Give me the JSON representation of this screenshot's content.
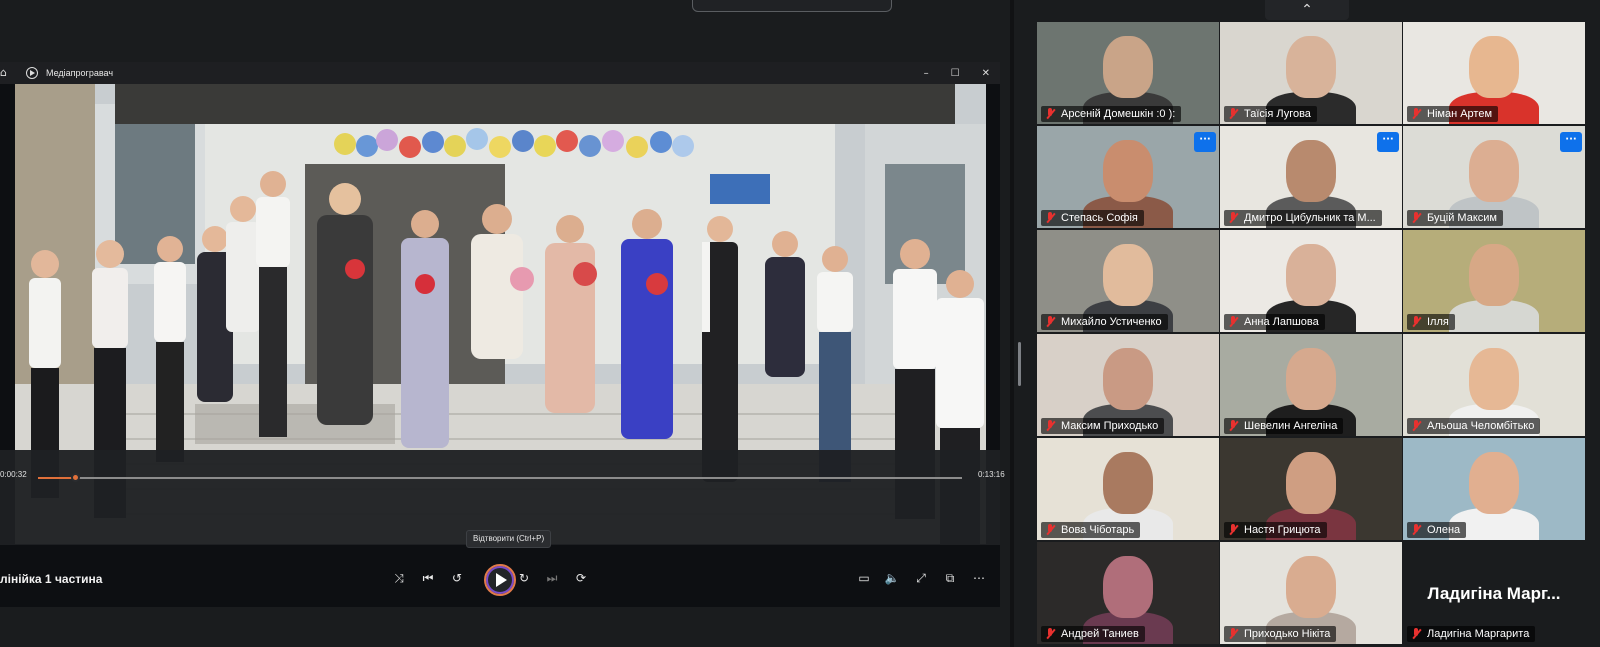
{
  "player": {
    "window_title": "Медіапрогравач",
    "title_controls": [
      "–",
      "☐",
      "✕"
    ],
    "current_time": "0:00:32",
    "total_time": "0:13:16",
    "progress_fraction": 0.04,
    "tooltip": "Відтворити (Ctrl+P)",
    "media_title": "лінійка 1 частина",
    "icons": {
      "shuffle": "⤨",
      "previous": "⏮",
      "rewind": "↺",
      "play": "play-icon",
      "forward": "↻",
      "next": "⏭",
      "repeat": "⟳",
      "captions": "▭",
      "volume": "🔈",
      "fullscreen": "⤢",
      "miniplayer": "⧉",
      "more": "⋯"
    },
    "accent": "#e0703a"
  },
  "gallery": {
    "collapse_icon": "⌃",
    "more_label": "···",
    "tiles": [
      {
        "name": "Арсеній Домешкін :0 ):",
        "bg": "#6d7570",
        "face": "#c9a488",
        "shirt": "#3a3a3a",
        "more": false
      },
      {
        "name": "Таїсія Лугова",
        "bg": "#d9d6cf",
        "face": "#d8b39a",
        "shirt": "#2b2b2b",
        "more": false
      },
      {
        "name": "Німан Артем",
        "bg": "#e9e7e2",
        "face": "#e7b790",
        "shirt": "#d9332b",
        "more": false
      },
      {
        "name": "Степась Софія",
        "bg": "#9aa6a9",
        "face": "#c98d6e",
        "shirt": "#8b5a48",
        "more": true
      },
      {
        "name": "Дмитро Цибульник та М...",
        "bg": "#e8e6e0",
        "face": "#b88a6e",
        "shirt": "#5b5b5b",
        "more": true
      },
      {
        "name": "Буцій Максим",
        "bg": "#dcdcd6",
        "face": "#dcae92",
        "shirt": "#bfc4c6",
        "more": true
      },
      {
        "name": "Михайло Устиченко",
        "bg": "#8f8f88",
        "face": "#e1bb9c",
        "shirt": "#3d3f43",
        "more": false
      },
      {
        "name": "Анна Лапшова",
        "bg": "#ece9e4",
        "face": "#d9b199",
        "shirt": "#262626",
        "more": false
      },
      {
        "name": "Ілля",
        "bg": "#b6ad7a",
        "face": "#d7a886",
        "shirt": "#d6d7d2",
        "more": false
      },
      {
        "name": "Максим Приходько",
        "bg": "#d8d0c8",
        "face": "#c99a84",
        "shirt": "#4c4d4f",
        "more": false
      },
      {
        "name": "Шевелин Ангеліна",
        "bg": "#a8aba1",
        "face": "#d6a98e",
        "shirt": "#1e1e1e",
        "more": false
      },
      {
        "name": "Альоша Челомбітько",
        "bg": "#e2e0d7",
        "face": "#e6b895",
        "shirt": "#f0f0ef",
        "more": false
      },
      {
        "name": "Вова Чіботарь",
        "bg": "#e6e1d6",
        "face": "#a97a60",
        "shirt": "#e9e9e9",
        "more": false
      },
      {
        "name": "Настя Грицюта",
        "bg": "#3b3730",
        "face": "#cf9e82",
        "shirt": "#7a3540",
        "more": false
      },
      {
        "name": "Олена",
        "bg": "#9db9c6",
        "face": "#e1af90",
        "shirt": "#f1f1f1",
        "more": false
      },
      {
        "name": "Андрей Таниев",
        "bg": "#2c2a29",
        "face": "#b06e7a",
        "shirt": "#6a3a50",
        "more": false
      },
      {
        "name": "Приходько Нікіта",
        "bg": "#e4e2dc",
        "face": "#d9ac90",
        "shirt": "#b5a9a0",
        "more": false
      },
      {
        "name": "Ладигіна Маргарита",
        "bg": "#1a1c1e",
        "face": "",
        "shirt": "",
        "more": false,
        "avatar_text": "Ладигіна Марг..."
      }
    ]
  }
}
